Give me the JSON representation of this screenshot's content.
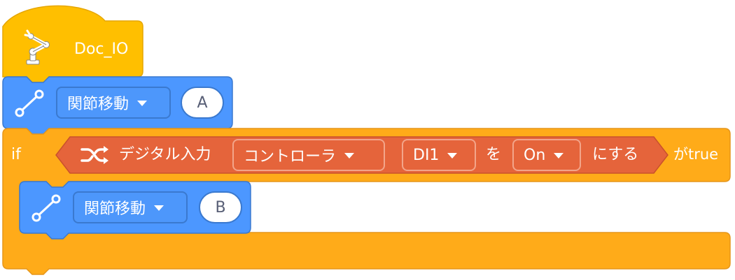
{
  "hat_block": {
    "label": "Doc_IO",
    "icon": "robot-arm-icon",
    "color": "#ffbf00"
  },
  "move_block_1": {
    "icon": "joint-move-icon",
    "dropdown": "関節移動",
    "target": "A",
    "color": "#4c97ff"
  },
  "if_block": {
    "label": "if",
    "suffix": "がtrue",
    "color": "#ffab19",
    "condition": {
      "icon": "shuffle-icon",
      "prefix": "デジタル入力",
      "device_dropdown": "コントローラ",
      "port_dropdown": "DI1",
      "particle_wo": "を",
      "state_dropdown": "On",
      "suffix": "にする",
      "color": "#e5643b"
    }
  },
  "move_block_2": {
    "icon": "joint-move-icon",
    "dropdown": "関節移動",
    "target": "B",
    "color": "#4c97ff"
  }
}
